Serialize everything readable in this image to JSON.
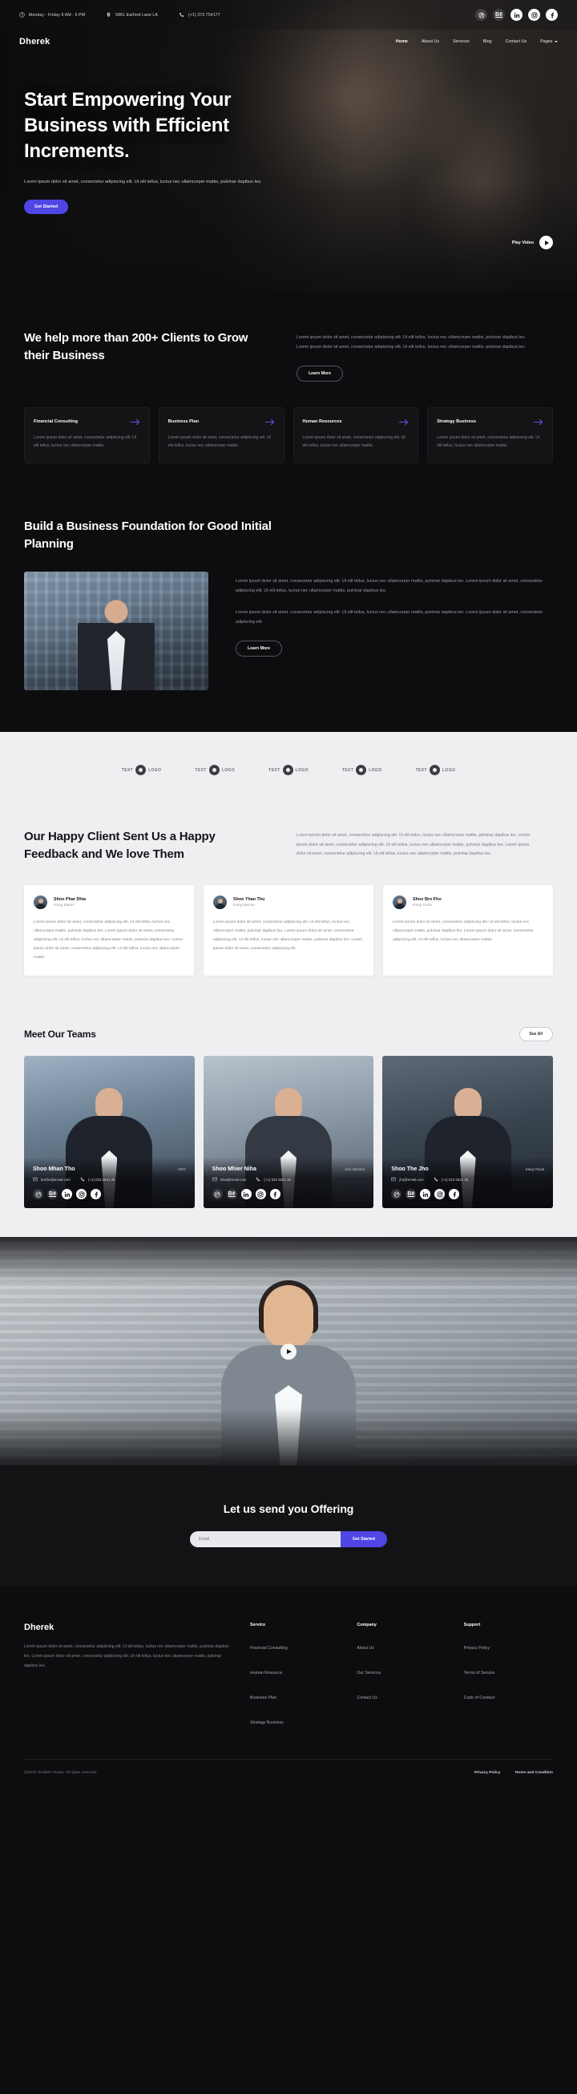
{
  "topbar": {
    "hours": "Monday - Friday 9 AM - 5 PM",
    "address": "5861 Earford Lane LA",
    "phone": "(+1) 373 754177",
    "socials": [
      "dribbble-icon",
      "behance-icon",
      "linkedin-icon",
      "instagram-icon",
      "facebook-icon"
    ]
  },
  "nav": {
    "brand": "Dherek",
    "links": [
      {
        "label": "Home",
        "active": true
      },
      {
        "label": "About Us",
        "active": false
      },
      {
        "label": "Services",
        "active": false
      },
      {
        "label": "Blog",
        "active": false
      },
      {
        "label": "Contact Us",
        "active": false
      },
      {
        "label": "Pages",
        "active": false,
        "caret": true
      }
    ]
  },
  "hero": {
    "heading": "Start Empowering Your Business with Efficient Increments.",
    "paragraph": "Lorem ipsum dolor sit amet, consectetur adipiscing elit. Ut elit tellus, luctus nec ullamcorper mattis, pulvinar dapibus leo.",
    "cta": "Get Started",
    "play_label": "Play Video"
  },
  "clients": {
    "heading": "We help more than 200+ Clients to Grow their Business",
    "paragraph": "Lorem ipsum dolor sit amet, consectetur adipiscing elit. Ut elit tellus, luctus nec ullamcorper mattis, pulvinar dapibus leo. Lorem ipsum dolor sit amet, consectetur adipiscing elit. Ut elit tellus, luctus nec ullamcorper mattis, pulvinar dapibus leo.",
    "cta": "Learn More",
    "cards": [
      {
        "title": "Financial Consulting",
        "text": "Lorem ipsum dolor sit amet, consectetur adipiscing elit. Ut elit tellus, luctus nec ullamcorper mattis."
      },
      {
        "title": "Business Plan",
        "text": "Lorem ipsum dolor sit amet, consectetur adipiscing elit. Ut elit tellus, luctus nec ullamcorper mattis."
      },
      {
        "title": "Human Resources",
        "text": "Lorem ipsum dolor sit amet, consectetur adipiscing elit. Ut elit tellus, luctus nec ullamcorper mattis."
      },
      {
        "title": "Strategy Business",
        "text": "Lorem ipsum dolor sit amet, consectetur adipiscing elit. Ut elit tellus, luctus nec ullamcorper mattis."
      }
    ]
  },
  "foundation": {
    "heading": "Build a Business Foundation for Good Initial Planning",
    "paragraph1": "Lorem ipsum dolor sit amet, consectetur adipiscing elit. Ut elit tellus, luctus nec ullamcorper mattis, pulvinar dapibus leo. Lorem ipsum dolor sit amet, consectetur adipiscing elit. Ut elit tellus, luctus nec ullamcorper mattis, pulvinar dapibus leo.",
    "paragraph2": "Lorem ipsum dolor sit amet, consectetur adipiscing elit. Ut elit tellus, luctus nec ullamcorper mattis, pulvinar dapibus leo. Lorem ipsum dolor sit amet, consectetur adipiscing elit.",
    "cta": "Learn More"
  },
  "logos": [
    {
      "text": "TEXT",
      "sub": "LOGO"
    },
    {
      "text": "TEXT",
      "sub": "LOGO"
    },
    {
      "text": "TEXT",
      "sub": "LOGO"
    },
    {
      "text": "TEXT",
      "sub": "LOGO"
    },
    {
      "text": "TEXT",
      "sub": "LOGO"
    }
  ],
  "testimonials": {
    "heading": "Our Happy Client Sent Us a Happy Feedback and We love Them",
    "paragraph": "Lorem ipsum dolor sit amet, consectetur adipiscing elit. Ut elit tellus, luctus nec ullamcorper mattis, pulvinar dapibus leo. Lorem ipsum dolor sit amet, consectetur adipiscing elit. Ut elit tellus, luctus nec ullamcorper mattis, pulvinar dapibus leo. Lorem ipsum dolor sit amet, consectetur adipiscing elit. Ut elit tellus, luctus nec ullamcorper mattis, pulvinar dapibus leo.",
    "cards": [
      {
        "name": "Shoo Phar Dhia",
        "role": "Kang Bakso",
        "text": "Lorem ipsum dolor sit amet, consectetur adipiscing elit. Ut elit tellus, luctus nec ullamcorper mattis, pulvinar dapibus leo. Lorem ipsum dolor sit amet, consectetur adipiscing elit. Ut elit tellus, luctus nec ullamcorper mattis, pulvinar dapibus leo. Lorem ipsum dolor sit amet, consectetur adipiscing elit. Ut elit tellus, luctus nec ullamcorper mattis."
      },
      {
        "name": "Shoo Yhan Thu",
        "role": "Kang Macan",
        "text": "Lorem ipsum dolor sit amet, consectetur adipiscing elit. Ut elit tellus, luctus nec ullamcorper mattis, pulvinar dapibus leo. Lorem ipsum dolor sit amet, consectetur adipiscing elit. Ut elit tellus, luctus nec ullamcorper mattis, pulvinar dapibus leo. Lorem ipsum dolor sit amet, consectetur adipiscing elit."
      },
      {
        "name": "Shoo Bro Fho",
        "role": "Kang Kuda",
        "text": "Lorem ipsum dolor sit amet, consectetur adipiscing elit. Ut elit tellus, luctus nec ullamcorper mattis, pulvinar dapibus leo. Lorem ipsum dolor sit amet, consectetur adipiscing elit. Ut elit tellus, luctus nec ullamcorper mattis."
      }
    ]
  },
  "teams": {
    "heading": "Meet Our Teams",
    "see_all": "See All",
    "members": [
      {
        "name": "Shoo Mhan Tho",
        "role": "CEO",
        "email": "brotho@email.com",
        "phone": "(+1) 023 2541 25"
      },
      {
        "name": "Shoo Mhier Niha",
        "role": "Vice Director",
        "email": "niha@email.com",
        "phone": "(+1) 023 2541 26"
      },
      {
        "name": "Shoo The Jho",
        "role": "Kang Visual",
        "email": "jho@email.com",
        "phone": "(+1) 023 2541 28"
      }
    ]
  },
  "cta": {
    "heading": "Let us send you Offering",
    "input_placeholder": "Email",
    "button": "Get Started"
  },
  "footer": {
    "brand": "Dherek",
    "about": "Lorem ipsum dolor sit amet, consectetur adipiscing elit. Ut elit tellus, luctus nec ullamcorper mattis, pulvinar dapibus leo. Lorem ipsum dolor sit amet, consectetur adipiscing elit. Ut elit tellus, luctus nec ullamcorper mattis, pulvinar dapibus leo.",
    "columns": [
      {
        "title": "Service",
        "links": [
          "Financial Consulting",
          "Human Resource",
          "Business Plan",
          "Stratagy Business"
        ]
      },
      {
        "title": "Company",
        "links": [
          "About Us",
          "Our Services",
          "Contact Us"
        ]
      },
      {
        "title": "Support",
        "links": [
          "Privacy Policy",
          "Terms of Service",
          "Code of Conduct"
        ]
      }
    ],
    "copyright": "@2023 Terafirhr Studio. All rights reserved.",
    "legal": [
      "Privacy Policy",
      "Terms and Condition"
    ]
  },
  "colors": {
    "accent": "#4f46e5",
    "dark_bg": "#0d0d0f",
    "light_bg": "#efeff1"
  }
}
